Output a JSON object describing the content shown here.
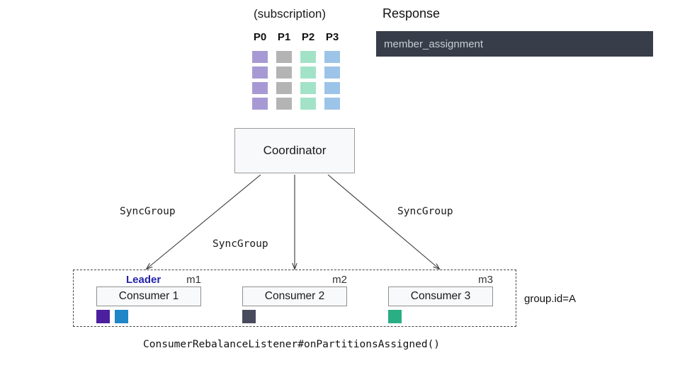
{
  "diagram": {
    "subscription": {
      "caption": "(subscription)",
      "partitions": [
        {
          "name": "P0",
          "color": "#a79ad4",
          "rows": 4
        },
        {
          "name": "P1",
          "color": "#b4b4b4",
          "rows": 4
        },
        {
          "name": "P2",
          "color": "#a2e3c8",
          "rows": 4
        },
        {
          "name": "P3",
          "color": "#9cc4e8",
          "rows": 4
        }
      ]
    },
    "response": {
      "title": "Response",
      "field": "member_assignment",
      "box_color": "#373d49",
      "text_color": "#c9cdd4"
    },
    "coordinator": {
      "label": "Coordinator"
    },
    "edges": [
      {
        "label": "SyncGroup",
        "target": "Consumer 1"
      },
      {
        "label": "SyncGroup",
        "target": "Consumer 2"
      },
      {
        "label": "SyncGroup",
        "target": "Consumer 3"
      }
    ],
    "group": {
      "id_label": "group.id=A",
      "consumers": [
        {
          "name": "Consumer 1",
          "member_id": "m1",
          "role": "Leader",
          "is_leader": true,
          "assignments": [
            "#4b1f9e",
            "#1f86c8"
          ]
        },
        {
          "name": "Consumer 2",
          "member_id": "m2",
          "role": "",
          "is_leader": false,
          "assignments": [
            "#474b5c"
          ]
        },
        {
          "name": "Consumer 3",
          "member_id": "m3",
          "role": "",
          "is_leader": false,
          "assignments": [
            "#2aae84"
          ]
        }
      ]
    },
    "footer": {
      "caption": "ConsumerRebalanceListener#onPartitionsAssigned()"
    }
  }
}
